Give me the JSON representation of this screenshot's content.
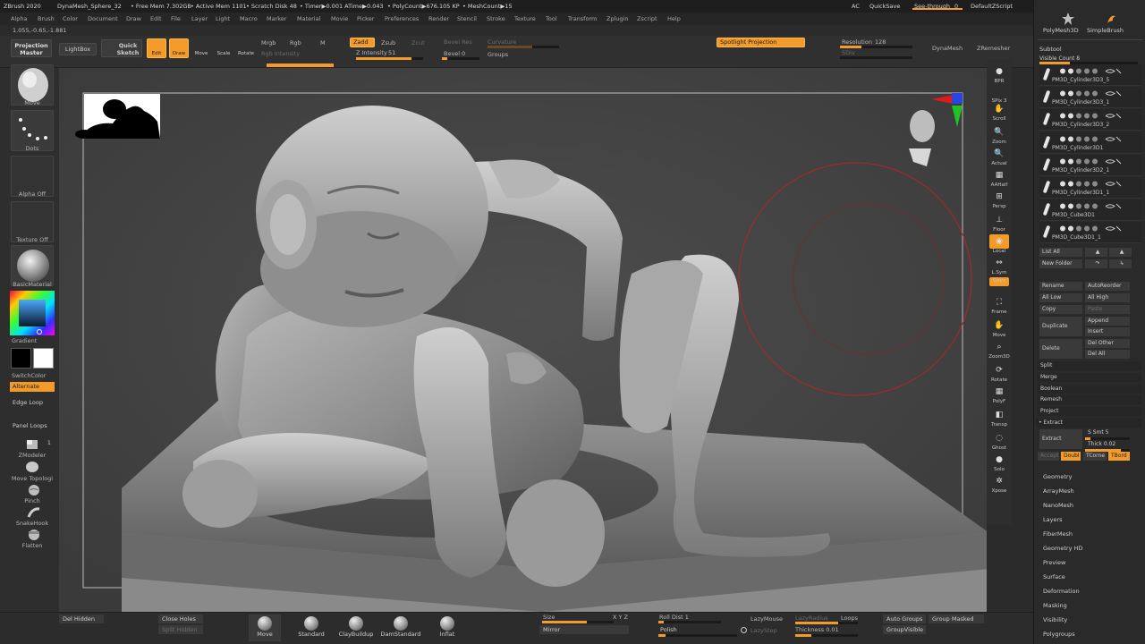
{
  "titlebar": {
    "app": "ZBrush 2020",
    "doc": "DynaMesh_Sphere_32",
    "free_mem": "• Free Mem 7.302GB",
    "active_mem": "• Active Mem 1101",
    "scratch": "• Scratch Disk 48",
    "timer": "• Timer▶0.001 ATime▶0.043",
    "polycount": "• PolyCount▶676.105 KP",
    "meshcount": "• MeshCount▶15",
    "ac": "AC",
    "quicksave": "QuickSave",
    "seethrough": "See-through",
    "seethrough_val": "0",
    "zscript": "DefaultZScript"
  },
  "menu": [
    "Alpha",
    "Brush",
    "Color",
    "Document",
    "Draw",
    "Edit",
    "File",
    "Layer",
    "Light",
    "Macro",
    "Marker",
    "Material",
    "Movie",
    "Picker",
    "Preferences",
    "Render",
    "Stencil",
    "Stroke",
    "Texture",
    "Tool",
    "Transform",
    "Zplugin",
    "Zscript",
    "Help"
  ],
  "coords": "1.055,-0.65,-1.881",
  "toolbar": {
    "projection_master": "Projection Master",
    "lightbox": "LightBox",
    "quick_sketch": "Quick Sketch",
    "edit": "Edit",
    "draw": "Draw",
    "move": "Move",
    "scale": "Scale",
    "rotate": "Rotate",
    "mrgb": "Mrgb",
    "rgb": "Rgb",
    "m": "M",
    "rgb_intensity": "Rgb Intensity",
    "zadd": "Zadd",
    "zsub": "Zsub",
    "zcut": "Zcut",
    "z_intensity": "Z Intensity",
    "z_intensity_val": "51",
    "bevel_res": "Bevel Res",
    "bevel": "Bevel",
    "bevel_val": "0",
    "curvature": "Curvature",
    "groups": "Groups",
    "spotlight_projection": "Spotlight Projection",
    "resolution": "Resolution",
    "resolution_val": "128",
    "sdiv": "SDiv",
    "dynamesh": "DynaMesh",
    "zremesher": "ZRemesher"
  },
  "left_shelf": {
    "move": "Move",
    "dots": "Dots",
    "alpha_off": "Alpha Off",
    "texture_off": "Texture Off",
    "basic_material": "BasicMaterial",
    "gradient": "Gradient",
    "switch_color": "SwitchColor",
    "alternate": "Alternate",
    "edge_loop": "Edge Loop",
    "panel_loops": "Panel Loops",
    "zmodeler": "ZModeler",
    "zmodeler_count": "1",
    "move_topological": "Move Topologi",
    "pinch": "Pinch",
    "snakehook": "SnakeHook",
    "flatten": "Flatten"
  },
  "right_shelf": [
    {
      "label": "BPR"
    },
    {
      "label": "SPix 3"
    },
    {
      "label": "Scroll"
    },
    {
      "label": "Zoom"
    },
    {
      "label": "Actual"
    },
    {
      "label": "AAHalf"
    },
    {
      "label": "Persp"
    },
    {
      "label": "Floor"
    },
    {
      "label": "Local"
    },
    {
      "label": "L.Sym"
    },
    {
      "label": "Qxyz"
    },
    {
      "label": "Frame"
    },
    {
      "label": "Move"
    },
    {
      "label": "Zoom3D"
    },
    {
      "label": "Rotate"
    },
    {
      "label": "PolyF"
    },
    {
      "label": "Transp"
    },
    {
      "label": "Ghost"
    },
    {
      "label": "Solo"
    },
    {
      "label": "Xpose"
    }
  ],
  "tray": {
    "polymesh3d": "PolyMesh3D",
    "simplebrush": "SimpleBrush",
    "subtool": "Subtool",
    "visible_count": "Visible Count 8",
    "subtools": [
      "PM3D_Cylinder3D3_5",
      "PM3D_Cylinder3D3_1",
      "PM3D_Cylinder3D3_2",
      "PM3D_Cylinder3D1",
      "PM3D_Cylinder3D2_1",
      "PM3D_Cylinder3D1_1",
      "PM3D_Cube3D1",
      "PM3D_Cube3D1_1"
    ],
    "list_all": "List All",
    "new_folder": "New Folder",
    "rename": "Rename",
    "auto_reorder": "AutoReorder",
    "all_low": "All Low",
    "all_high": "All High",
    "copy": "Copy",
    "paste": "Paste",
    "duplicate": "Duplicate",
    "append": "Append",
    "insert": "Insert",
    "delete": "Delete",
    "del_other": "Del Other",
    "del_all": "Del All",
    "split": "Split",
    "merge": "Merge",
    "boolean": "Boolean",
    "remesh": "Remesh",
    "project": "Project",
    "extract_header": "• Extract",
    "extract": "Extract",
    "s_smt": "S Smt 5",
    "thick": "Thick 0.02",
    "accept": "Accept",
    "double": "Doubl",
    "tcorner": "TCorne",
    "tborder": "TBord",
    "palettes": [
      "Geometry",
      "ArrayMesh",
      "NanoMesh",
      "Layers",
      "FiberMesh",
      "Geometry HD",
      "Preview",
      "Surface",
      "Deformation",
      "Masking",
      "Visibility",
      "Polygroups"
    ]
  },
  "bottom": {
    "del_hidden": "Del Hidden",
    "close_holes": "Close Holes",
    "split_hidden": "Split Hidden",
    "brushes": [
      "Move",
      "Standard",
      "ClayBuildup",
      "DamStandard",
      "Inflat"
    ],
    "size": "Size",
    "mirror": "Mirror",
    "xyz": "X Y Z",
    "roll_dist": "Roll Dist 1",
    "polish": "Polish",
    "lazymouse": "LazyMouse",
    "lazyradius": "LazyRadius",
    "lazystep": "LazyStep",
    "loops": "Loops",
    "thickness": "Thickness 0.01",
    "auto_groups": "Auto Groups",
    "group_masked": "Group Masked",
    "groupvisible": "GroupVisible"
  }
}
